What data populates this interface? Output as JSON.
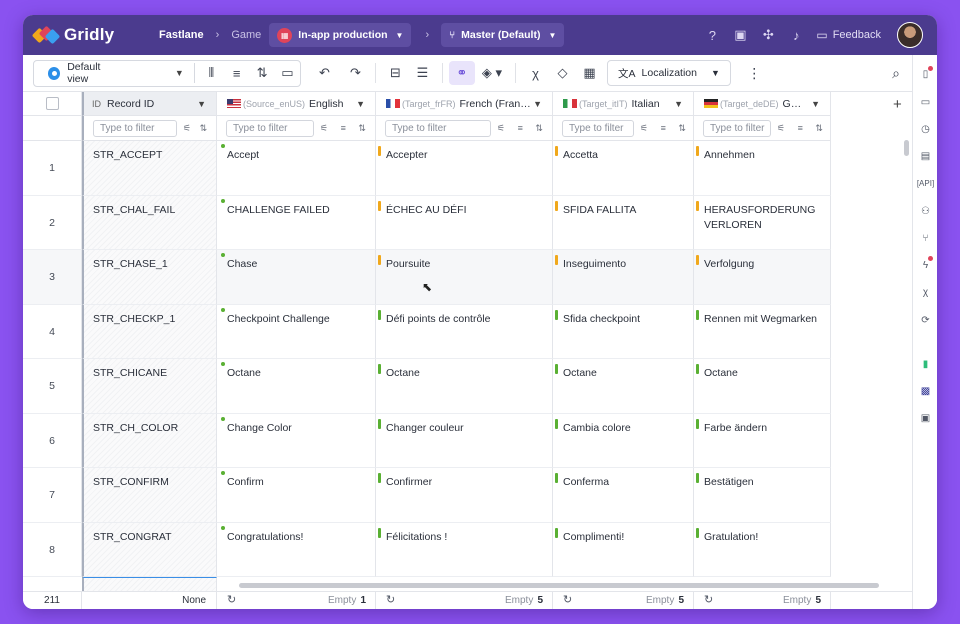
{
  "app": {
    "logo_text": "Gridly",
    "breadcrumbs": [
      "Fastlane",
      "Game"
    ],
    "project_label": "In-app production",
    "branch_label": "Master (Default)",
    "feedback_label": "Feedback"
  },
  "toolbar": {
    "view_label": "Default view",
    "localization_label": "Localization"
  },
  "columns": [
    {
      "code": "",
      "label": "Record ID",
      "flag": ""
    },
    {
      "code": "(Source_enUS)",
      "label": "English",
      "flag": "us"
    },
    {
      "code": "(Target_frFR)",
      "label": "French (Fran…",
      "flag": "fr"
    },
    {
      "code": "(Target_itIT)",
      "label": "Italian",
      "flag": "it"
    },
    {
      "code": "(Target_deDE)",
      "label": "G…",
      "flag": "de"
    }
  ],
  "filter_placeholder": "Type to filter",
  "rows": [
    {
      "num": "1",
      "id": "STR_ACCEPT",
      "en": "Accept",
      "fr": "Accepter",
      "it": "Accetta",
      "de": "Annehmen"
    },
    {
      "num": "2",
      "id": "STR_CHAL_FAIL",
      "en": "CHALLENGE FAILED",
      "fr": "ÉCHEC AU DÉFI",
      "it": "SFIDA FALLITA",
      "de": "HERAUSFORDERUNG VERLOREN"
    },
    {
      "num": "3",
      "id": "STR_CHASE_1",
      "en": "Chase",
      "fr": "Poursuite",
      "it": "Inseguimento",
      "de": "Verfolgung"
    },
    {
      "num": "4",
      "id": "STR_CHECKP_1",
      "en": "Checkpoint Challenge",
      "fr": "Défi points de contrôle",
      "it": "Sfida checkpoint",
      "de": "Rennen mit Wegmarken"
    },
    {
      "num": "5",
      "id": "STR_CHICANE",
      "en": "Octane",
      "fr": "Octane",
      "it": "Octane",
      "de": "Octane"
    },
    {
      "num": "6",
      "id": "STR_CH_COLOR",
      "en": "Change Color",
      "fr": "Changer couleur",
      "it": "Cambia colore",
      "de": "Farbe ändern"
    },
    {
      "num": "7",
      "id": "STR_CONFIRM",
      "en": "Confirm",
      "fr": "Confirmer",
      "it": "Conferma",
      "de": "Bestätigen"
    },
    {
      "num": "8",
      "id": "STR_CONGRAT",
      "en": "Congratulations!",
      "fr": "Félicitations !",
      "it": "Complimenti!",
      "de": "Gratulation!"
    }
  ],
  "status_colors": {
    "needs_review": "#f0a81c",
    "done": "#5ab033"
  },
  "row_markers": [
    [
      "done",
      "needs_review",
      "needs_review",
      "needs_review"
    ],
    [
      "done",
      "needs_review",
      "needs_review",
      "needs_review"
    ],
    [
      "done",
      "needs_review",
      "needs_review",
      "needs_review"
    ],
    [
      "done",
      "done",
      "done",
      "done"
    ],
    [
      "done",
      "done",
      "done",
      "done"
    ],
    [
      "done",
      "done",
      "done",
      "done"
    ],
    [
      "done",
      "done",
      "done",
      "done"
    ],
    [
      "done",
      "done",
      "done",
      "done"
    ]
  ],
  "footer": {
    "total_rows": "211",
    "id_summary": "None",
    "empty_label": "Empty",
    "empty_counts": [
      "1",
      "5",
      "5",
      "5"
    ]
  },
  "accent": "#4b3b8e"
}
